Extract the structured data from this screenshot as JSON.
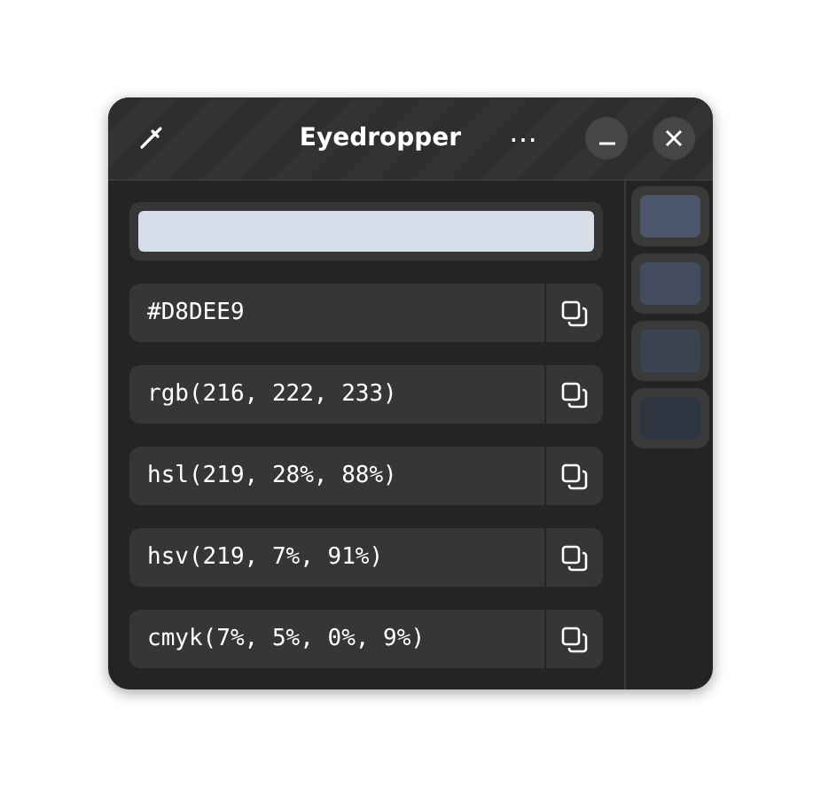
{
  "window": {
    "title": "Eyedropper",
    "menu_glyph": "⋯"
  },
  "preview": {
    "color": "#d8dee9"
  },
  "formats": [
    {
      "value": "#D8DEE9"
    },
    {
      "value": "rgb(216, 222, 233)"
    },
    {
      "value": "hsl(219, 28%, 88%)"
    },
    {
      "value": "hsv(219, 7%, 91%)"
    },
    {
      "value": "cmyk(7%, 5%, 0%, 9%)"
    }
  ],
  "history": [
    {
      "color": "#4c566a"
    },
    {
      "color": "#434c5e"
    },
    {
      "color": "#3b4252"
    },
    {
      "color": "#2e3440"
    }
  ]
}
